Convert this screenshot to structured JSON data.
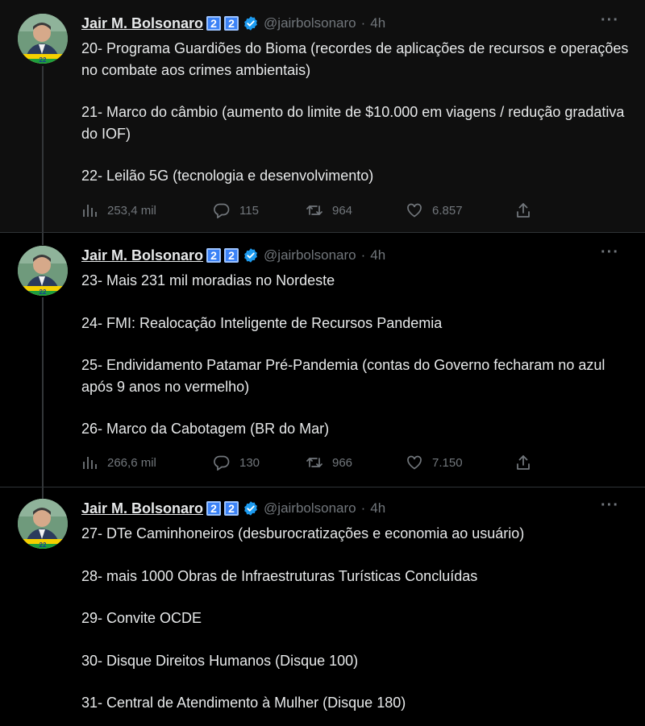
{
  "author": {
    "name": "Jair M. Bolsonaro",
    "badges": [
      "2",
      "2"
    ],
    "handle": "@jairbolsonaro",
    "time": "4h",
    "verified_icon": "verified-badge-icon",
    "badge_color": "#3b82f6",
    "verified_color": "#1d9bf0"
  },
  "tweets": [
    {
      "lines": [
        "20- Programa Guardiões do Bioma (recordes de aplicações de recursos e operações no combate aos crimes ambientais)",
        "21- Marco do câmbio (aumento do limite de $10.000 em viagens / redução gradativa do IOF)",
        "22- Leilão 5G (tecnologia e desenvolvimento)"
      ],
      "views": "253,4 mil",
      "replies": "115",
      "retweets": "964",
      "likes": "6.857"
    },
    {
      "lines": [
        "23- Mais 231 mil moradias no Nordeste",
        "24- FMI: Realocação Inteligente de Recursos Pandemia",
        "25- Endividamento Patamar Pré-Pandemia (contas do Governo fecharam no azul após 9 anos no vermelho)",
        "26- Marco da Cabotagem (BR do Mar)"
      ],
      "views": "266,6 mil",
      "replies": "130",
      "retweets": "966",
      "likes": "7.150"
    },
    {
      "lines": [
        "27- DTe Caminhoneiros (desburocratizações e economia ao usuário)",
        "28- mais 1000 Obras de Infraestruturas Turísticas Concluídas",
        "29- Convite OCDE",
        "30- Disque Direitos Humanos (Disque 100)",
        "31- Central de Atendimento à Mulher (Disque 180)"
      ]
    }
  ],
  "more_label": "···"
}
